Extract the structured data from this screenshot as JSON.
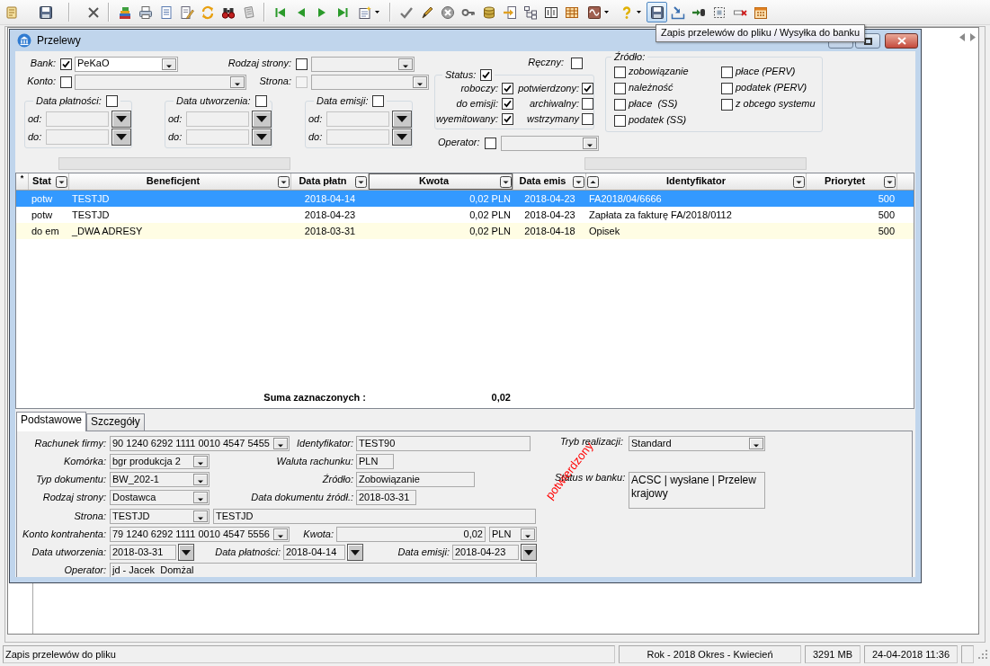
{
  "toolbar": {
    "groups": [
      [
        {
          "kind": "scroll",
          "selected": false,
          "dropdown": false
        },
        {
          "kind": "floppy",
          "selected": false,
          "dropdown": false
        }
      ],
      [
        {
          "kind": "cross",
          "selected": false,
          "dropdown": false
        }
      ],
      [
        {
          "kind": "books",
          "selected": false,
          "dropdown": false
        },
        {
          "kind": "printer",
          "selected": false,
          "dropdown": false
        },
        {
          "kind": "document",
          "selected": false,
          "dropdown": false
        },
        {
          "kind": "edit",
          "selected": false,
          "dropdown": false
        },
        {
          "kind": "refresh",
          "selected": false,
          "dropdown": false
        },
        {
          "kind": "binoculars",
          "selected": false,
          "dropdown": false
        },
        {
          "kind": "notepad",
          "selected": false,
          "dropdown": false
        }
      ],
      [
        {
          "kind": "first",
          "selected": false,
          "dropdown": false
        },
        {
          "kind": "previous",
          "selected": false,
          "dropdown": false
        },
        {
          "kind": "next",
          "selected": false,
          "dropdown": false
        },
        {
          "kind": "last",
          "selected": false,
          "dropdown": false
        },
        {
          "kind": "newdoc",
          "selected": false,
          "dropdown": true
        }
      ],
      [
        {
          "kind": "check",
          "selected": false,
          "dropdown": false
        },
        {
          "kind": "pen",
          "selected": false,
          "dropdown": false
        },
        {
          "kind": "cancel",
          "selected": false,
          "dropdown": false
        },
        {
          "kind": "key",
          "selected": false,
          "dropdown": false
        },
        {
          "kind": "database",
          "selected": false,
          "dropdown": false
        },
        {
          "kind": "import",
          "selected": false,
          "dropdown": false
        },
        {
          "kind": "tree",
          "selected": false,
          "dropdown": false
        },
        {
          "kind": "columns",
          "selected": false,
          "dropdown": false
        },
        {
          "kind": "table",
          "selected": false,
          "dropdown": false
        },
        {
          "kind": "wave",
          "selected": false,
          "dropdown": true
        },
        {
          "kind": "help",
          "selected": false,
          "dropdown": true
        },
        {
          "kind": "floppy",
          "selected": true,
          "dropdown": false
        },
        {
          "kind": "tray",
          "selected": false,
          "dropdown": false
        },
        {
          "kind": "transfer",
          "selected": false,
          "dropdown": false
        },
        {
          "kind": "selection",
          "selected": false,
          "dropdown": false
        },
        {
          "kind": "deleterow",
          "selected": false,
          "dropdown": false
        },
        {
          "kind": "calendar",
          "selected": false,
          "dropdown": false
        }
      ]
    ],
    "tooltip": "Zapis przelewów do pliku / Wysyłka do banku"
  },
  "window": {
    "title": "Przelewy"
  },
  "filters": {
    "rows": [
      [
        {
          "label": "Bank:",
          "checked": true,
          "checkbox_disabled": false,
          "value": "PeKaO",
          "disabled": false
        },
        {
          "label": "Rodzaj strony:",
          "checked": false,
          "checkbox_disabled": false,
          "disabled": true
        }
      ],
      [
        {
          "label": "Konto:",
          "checked": false,
          "checkbox_disabled": false,
          "disabled": true
        },
        {
          "label": "Strona:",
          "checked": false,
          "checkbox_disabled": true,
          "disabled": true
        }
      ]
    ],
    "date_ranges": [
      {
        "label": "Data płatności:",
        "checked": false,
        "fields": [
          {
            "label": "od:",
            "disabled": true
          },
          {
            "label": "do:",
            "disabled": true
          }
        ]
      },
      {
        "label": "Data utworzenia:",
        "checked": false,
        "fields": [
          {
            "label": "od:",
            "disabled": true
          },
          {
            "label": "do:",
            "disabled": true
          }
        ]
      },
      {
        "label": "Data emisji:",
        "checked": false,
        "fields": [
          {
            "label": "od:",
            "disabled": true
          },
          {
            "label": "do:",
            "disabled": true
          }
        ]
      }
    ],
    "manual": {
      "label": "Ręczny:",
      "checked": false
    },
    "status": {
      "label": "Status:",
      "checked": true,
      "options": [
        {
          "label": "roboczy:",
          "checked": true
        },
        {
          "label": "potwierdzony:",
          "checked": true
        },
        {
          "label": "do emisji:",
          "checked": true
        },
        {
          "label": "archiwalny:",
          "checked": false
        },
        {
          "label": "wyemitowany:",
          "checked": true
        },
        {
          "label": "wstrzymany",
          "checked": false
        }
      ]
    },
    "operator": {
      "label": "Operator:",
      "checked": false,
      "disabled": true
    },
    "source": {
      "label": "Źródło:",
      "columns": [
        [
          {
            "label": "zobowiązanie",
            "checked": false
          },
          {
            "label": "należność",
            "checked": false
          },
          {
            "label": "płace  (SS)",
            "checked": false
          },
          {
            "label": "podatek (SS)",
            "checked": false
          }
        ],
        [
          {
            "label": "płace (PERV)",
            "checked": false
          },
          {
            "label": "podatek (PERV)",
            "checked": false
          },
          {
            "label": "z obcego systemu",
            "checked": false
          }
        ]
      ]
    }
  },
  "table": {
    "marker": "*",
    "columns": [
      {
        "label": "Stat",
        "sorted": false,
        "focused": false
      },
      {
        "label": "Beneficjent",
        "sorted": false,
        "focused": false
      },
      {
        "label": "Data płatn",
        "sorted": false,
        "focused": false
      },
      {
        "label": "Kwota",
        "sorted": false,
        "focused": true
      },
      {
        "label": "Data emis",
        "sorted": false,
        "focused": false
      },
      {
        "label": "Identyfikator",
        "sorted": true,
        "focused": false
      },
      {
        "label": "Priorytet",
        "sorted": false,
        "focused": false
      }
    ],
    "rows": [
      {
        "cells": [
          "potw",
          "TESTJD",
          "2018-04-14",
          "0,02 PLN",
          "2018-04-23",
          "FA2018/04/6666",
          "500"
        ],
        "selected": true,
        "highlighted": false
      },
      {
        "cells": [
          "potw",
          "TESTJD",
          "2018-04-23",
          "0,02 PLN",
          "2018-04-23",
          "Zapłata za fakturę FA/2018/0112",
          "500"
        ],
        "selected": false,
        "highlighted": false
      },
      {
        "cells": [
          "do em",
          "_DWA ADRESY",
          "2018-03-31",
          "0,02 PLN",
          "2018-04-18",
          "Opisek",
          "500"
        ],
        "selected": false,
        "highlighted": true
      }
    ],
    "sum": {
      "label": "Suma zaznaczonych :",
      "value": "0,02"
    }
  },
  "tabs": [
    {
      "label": "Podstawowe",
      "selected": true
    },
    {
      "label": "Szczegóły",
      "selected": false
    }
  ],
  "form": {
    "rows": [
      [
        {
          "kind": "combo",
          "label": "Rachunek firmy:",
          "value": "90 1240 6292 1111 0010 4547 5455"
        },
        {
          "kind": "field",
          "label": "Identyfikator:",
          "value": "TEST90"
        }
      ],
      [
        {
          "kind": "combo",
          "label": "Komórka:",
          "value": "bgr produkcja 2"
        },
        {
          "kind": "field",
          "label": "Waluta rachunku:",
          "value": "PLN"
        }
      ],
      [
        {
          "kind": "combo",
          "label": "Typ dokumentu:",
          "value": "BW_202-1"
        },
        {
          "kind": "field",
          "label": "Źródło:",
          "value": "Zobowiązanie"
        }
      ],
      [
        {
          "kind": "combo",
          "label": "Rodzaj strony:",
          "value": "Dostawca"
        },
        {
          "kind": "field",
          "label": "Data dokumentu źródł.:",
          "value": "2018-03-31"
        }
      ],
      [
        {
          "kind": "combo",
          "label": "Strona:",
          "value": "TESTJD"
        },
        {
          "kind": "field",
          "value": "TESTJD"
        }
      ],
      [
        {
          "kind": "combo",
          "label": "Konto kontrahenta:",
          "value": "79 1240 6292 1111 0010 4547 5556"
        },
        {
          "kind": "amount",
          "label": "Kwota:",
          "value": "0,02"
        },
        {
          "kind": "combo",
          "value": "PLN"
        }
      ],
      [
        {
          "kind": "date",
          "label": "Data utworzenia:",
          "value": "2018-03-31"
        },
        {
          "kind": "date",
          "label": "Data płatności:",
          "value": "2018-04-14"
        },
        {
          "kind": "date",
          "label": "Data emisji:",
          "value": "2018-04-23"
        }
      ],
      [
        {
          "kind": "field",
          "label": "Operator:",
          "value": "jd - Jacek  Domżal"
        }
      ]
    ],
    "side": [
      {
        "kind": "combo",
        "label": "Tryb realizacji:",
        "value": "Standard"
      },
      {
        "kind": "memo",
        "label": "Status w banku:",
        "value": "ACSC | wysłane | Przelew krajowy"
      }
    ],
    "stamp": "potwierdzony"
  },
  "status_bar": {
    "panels": [
      "Zapis przelewów do pliku",
      "Rok - 2018 Okres - Kwiecień",
      "3291 MB",
      "24-04-2018 11:36"
    ]
  }
}
